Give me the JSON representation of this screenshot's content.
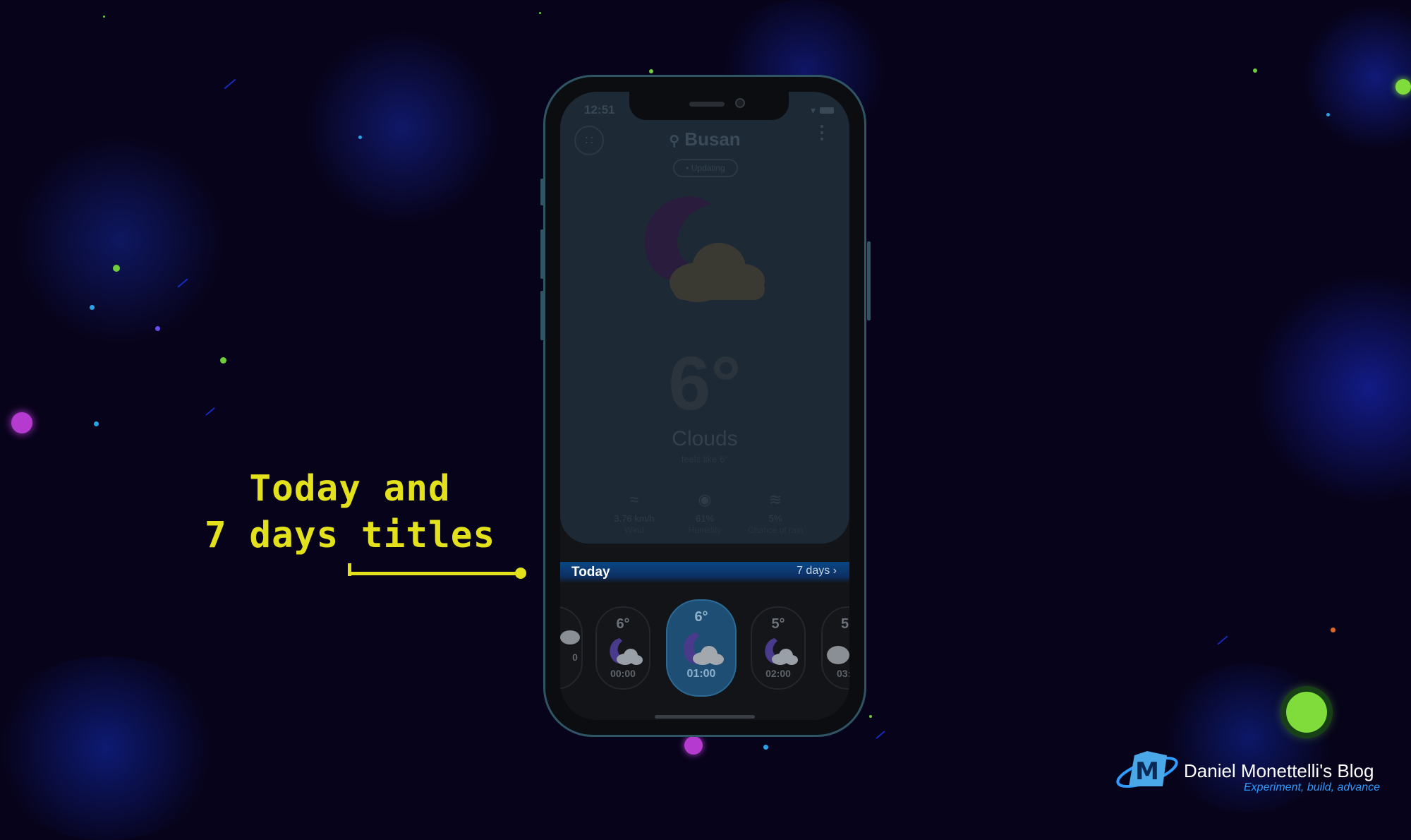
{
  "annotation": {
    "line1": "Today and",
    "line2": "7 days titles"
  },
  "phone": {
    "status_time": "12:51",
    "city": "Busan",
    "updating": "• Updating",
    "temperature": "6°",
    "condition": "Clouds",
    "feels_like": "feels like 6°",
    "stats": [
      {
        "icon": "wind-icon",
        "value": "3.76 km/h",
        "label": "Wind"
      },
      {
        "icon": "humidity-icon",
        "value": "61%",
        "label": "Humidity"
      },
      {
        "icon": "rain-chance-icon",
        "value": "5%",
        "label": "Chance of rain"
      }
    ],
    "today_label": "Today",
    "seven_days_label": "7 days",
    "hours": [
      {
        "temp": "",
        "hour": "0"
      },
      {
        "temp": "6°",
        "hour": "00:00"
      },
      {
        "temp": "6°",
        "hour": "01:00",
        "active": true
      },
      {
        "temp": "5°",
        "hour": "02:00"
      },
      {
        "temp": "5",
        "hour": "03:"
      }
    ]
  },
  "blog": {
    "title": "Daniel Monettelli's Blog",
    "tagline": "Experiment, build, advance",
    "logo_letter": "M"
  },
  "colors": {
    "accent_yellow": "#e3e11b",
    "background": "#07031a",
    "title_bar": "#0a4785",
    "active_hour": "#1e4e73"
  }
}
